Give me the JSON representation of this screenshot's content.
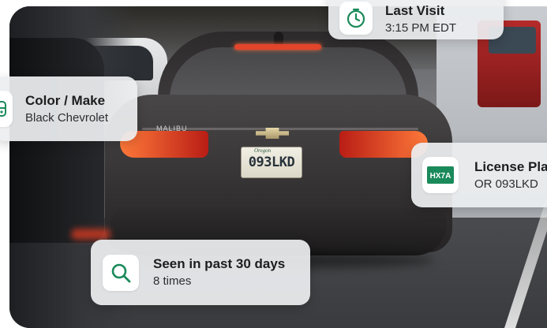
{
  "scene": {
    "vehicle_badge": "MALIBU",
    "plate_text": "093LKD",
    "plate_state": "Oregon"
  },
  "cards": {
    "last_visit": {
      "icon": "clock-icon",
      "title": "Last Visit",
      "value": "3:15 PM EDT"
    },
    "color_make": {
      "icon": "car-icon",
      "title": "Color / Make",
      "value": "Black Chevrolet"
    },
    "license_plate": {
      "icon": "license-plate-icon",
      "icon_text": "HX7A",
      "title": "License Plate",
      "value": "OR 093LKD"
    },
    "seen": {
      "icon": "search-icon",
      "title": "Seen in past 30 days",
      "value": "8 times"
    }
  },
  "colors": {
    "accent_green": "#1a8a5a",
    "card_bg": "#eceef0",
    "title_text": "#1c1d1f"
  }
}
